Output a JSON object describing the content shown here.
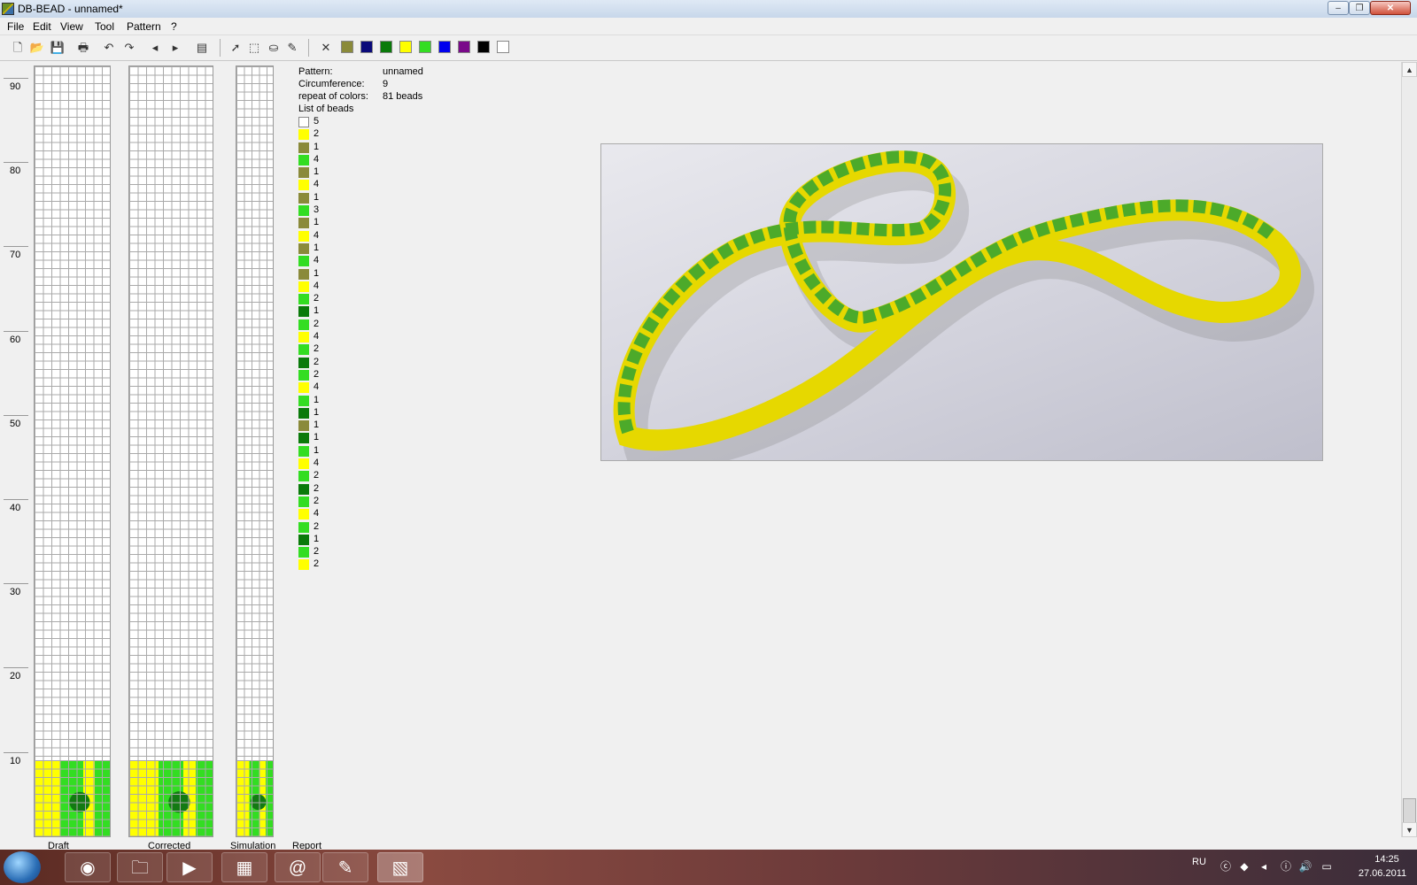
{
  "window": {
    "title": "DB-BEAD - unnamed*",
    "minimize": "–",
    "maximize": "❐",
    "close": "✕"
  },
  "menu": [
    "File",
    "Edit",
    "View",
    "Tool",
    "Pattern",
    "?"
  ],
  "toolbar": {
    "icons": [
      "new-icon",
      "open-icon",
      "save-icon",
      "print-icon",
      "undo-icon",
      "redo-icon",
      "arrow-left-icon",
      "arrow-right-icon",
      "preview-icon",
      "pointer-icon",
      "select-rect-icon",
      "fill-icon",
      "eyedropper-icon",
      "delete-color-icon"
    ],
    "palette": [
      "#8a8a3a",
      "#0a0a7a",
      "#0a7a0a",
      "#ffff00",
      "#33dd22",
      "#0000ee",
      "#7a0a8a",
      "#000000",
      "#ffffff"
    ]
  },
  "ruler": [
    "90",
    "80",
    "70",
    "60",
    "50",
    "40",
    "30",
    "20",
    "10"
  ],
  "columns": {
    "draft": "Draft",
    "corrected": "Corrected",
    "simulation": "Simulation",
    "report": "Report"
  },
  "info": {
    "pattern_label": "Pattern:",
    "pattern_value": "unnamed",
    "circumference_label": "Circumference:",
    "circumference_value": "9",
    "repeat_label": "repeat of colors:",
    "repeat_value": "81 beads",
    "list_label": "List of beads"
  },
  "beads": [
    {
      "color": "#ffffff",
      "n": "5"
    },
    {
      "color": "#ffff00",
      "n": "2"
    },
    {
      "color": "#8a8a3a",
      "n": "1"
    },
    {
      "color": "#33dd22",
      "n": "4"
    },
    {
      "color": "#8a8a3a",
      "n": "1"
    },
    {
      "color": "#ffff00",
      "n": "4"
    },
    {
      "color": "#8a8a3a",
      "n": "1"
    },
    {
      "color": "#33dd22",
      "n": "3"
    },
    {
      "color": "#8a8a3a",
      "n": "1"
    },
    {
      "color": "#ffff00",
      "n": "4"
    },
    {
      "color": "#8a8a3a",
      "n": "1"
    },
    {
      "color": "#33dd22",
      "n": "4"
    },
    {
      "color": "#8a8a3a",
      "n": "1"
    },
    {
      "color": "#ffff00",
      "n": "4"
    },
    {
      "color": "#33dd22",
      "n": "2"
    },
    {
      "color": "#0a7a0a",
      "n": "1"
    },
    {
      "color": "#33dd22",
      "n": "2"
    },
    {
      "color": "#ffff00",
      "n": "4"
    },
    {
      "color": "#33dd22",
      "n": "2"
    },
    {
      "color": "#0a7a0a",
      "n": "2"
    },
    {
      "color": "#33dd22",
      "n": "2"
    },
    {
      "color": "#ffff00",
      "n": "4"
    },
    {
      "color": "#33dd22",
      "n": "1"
    },
    {
      "color": "#0a7a0a",
      "n": "1"
    },
    {
      "color": "#8a8a3a",
      "n": "1"
    },
    {
      "color": "#0a7a0a",
      "n": "1"
    },
    {
      "color": "#33dd22",
      "n": "1"
    },
    {
      "color": "#ffff00",
      "n": "4"
    },
    {
      "color": "#33dd22",
      "n": "2"
    },
    {
      "color": "#0a7a0a",
      "n": "2"
    },
    {
      "color": "#33dd22",
      "n": "2"
    },
    {
      "color": "#ffff00",
      "n": "4"
    },
    {
      "color": "#33dd22",
      "n": "2"
    },
    {
      "color": "#0a7a0a",
      "n": "1"
    },
    {
      "color": "#33dd22",
      "n": "2"
    },
    {
      "color": "#ffff00",
      "n": "2"
    }
  ],
  "taskbar": {
    "apps": [
      "chrome-icon",
      "explorer-icon",
      "media-player-icon",
      "file-manager-icon",
      "snail-app-icon",
      "notepad-icon",
      "db-bead-icon"
    ],
    "lang": "RU",
    "time": "14:25",
    "date": "27.06.2011"
  }
}
